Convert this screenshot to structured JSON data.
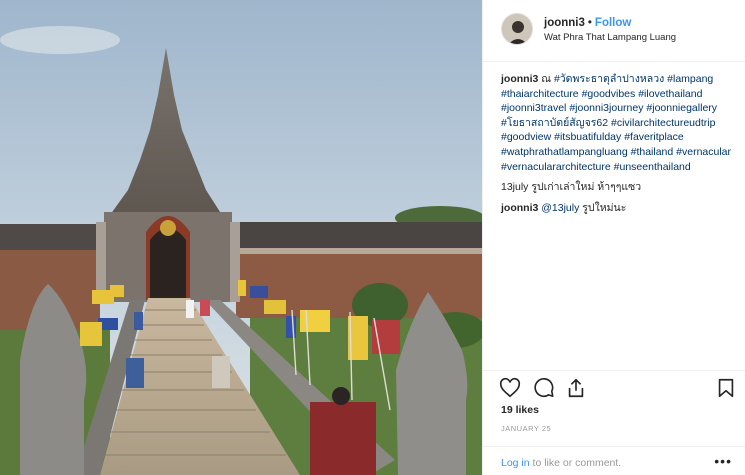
{
  "post": {
    "username": "joonni3",
    "follow_label": "Follow",
    "separator": "•",
    "location": "Wat Phra That Lampang Luang",
    "photo_alt": "Temple gate with naga stair rails and flags"
  },
  "caption": {
    "username": "joonni3",
    "text_prefix": "ณ",
    "hashtags": [
      "#วัดพระธาตุลำปางหลวง",
      "#lampang",
      "#thaiarchitecture",
      "#goodvibes",
      "#ilovethailand",
      "#joonni3travel",
      "#joonni3journey",
      "#joonniegallery",
      "#โยธาสถาบัตย์สัญจร62",
      "#civilarchitectureudtrip",
      "#goodview",
      "#itsbuatifulday",
      "#faveritplace",
      "#watphrathatlampangluang",
      "#thailand",
      "#vernacular",
      "#vernaculararchitecture",
      "#unseenthailand"
    ]
  },
  "comments": [
    {
      "text": "13july รูปเก่าเล่าใหม่ ห้าๆๆแซว"
    },
    {
      "user": "joonni3",
      "mention": "@13july",
      "text": "รูปใหม่นะ"
    }
  ],
  "actions": {
    "like_icon": "heart-icon",
    "comment_icon": "comment-icon",
    "share_icon": "share-icon",
    "save_icon": "bookmark-icon"
  },
  "likes_label": "19 likes",
  "date_label": "JANUARY 25",
  "footer": {
    "login_link": "Log in",
    "login_suffix": "to like or comment.",
    "more_label": "•••"
  },
  "colors": {
    "link": "#3897f0",
    "hashtag": "#003569",
    "muted": "#999999",
    "text": "#262626"
  }
}
